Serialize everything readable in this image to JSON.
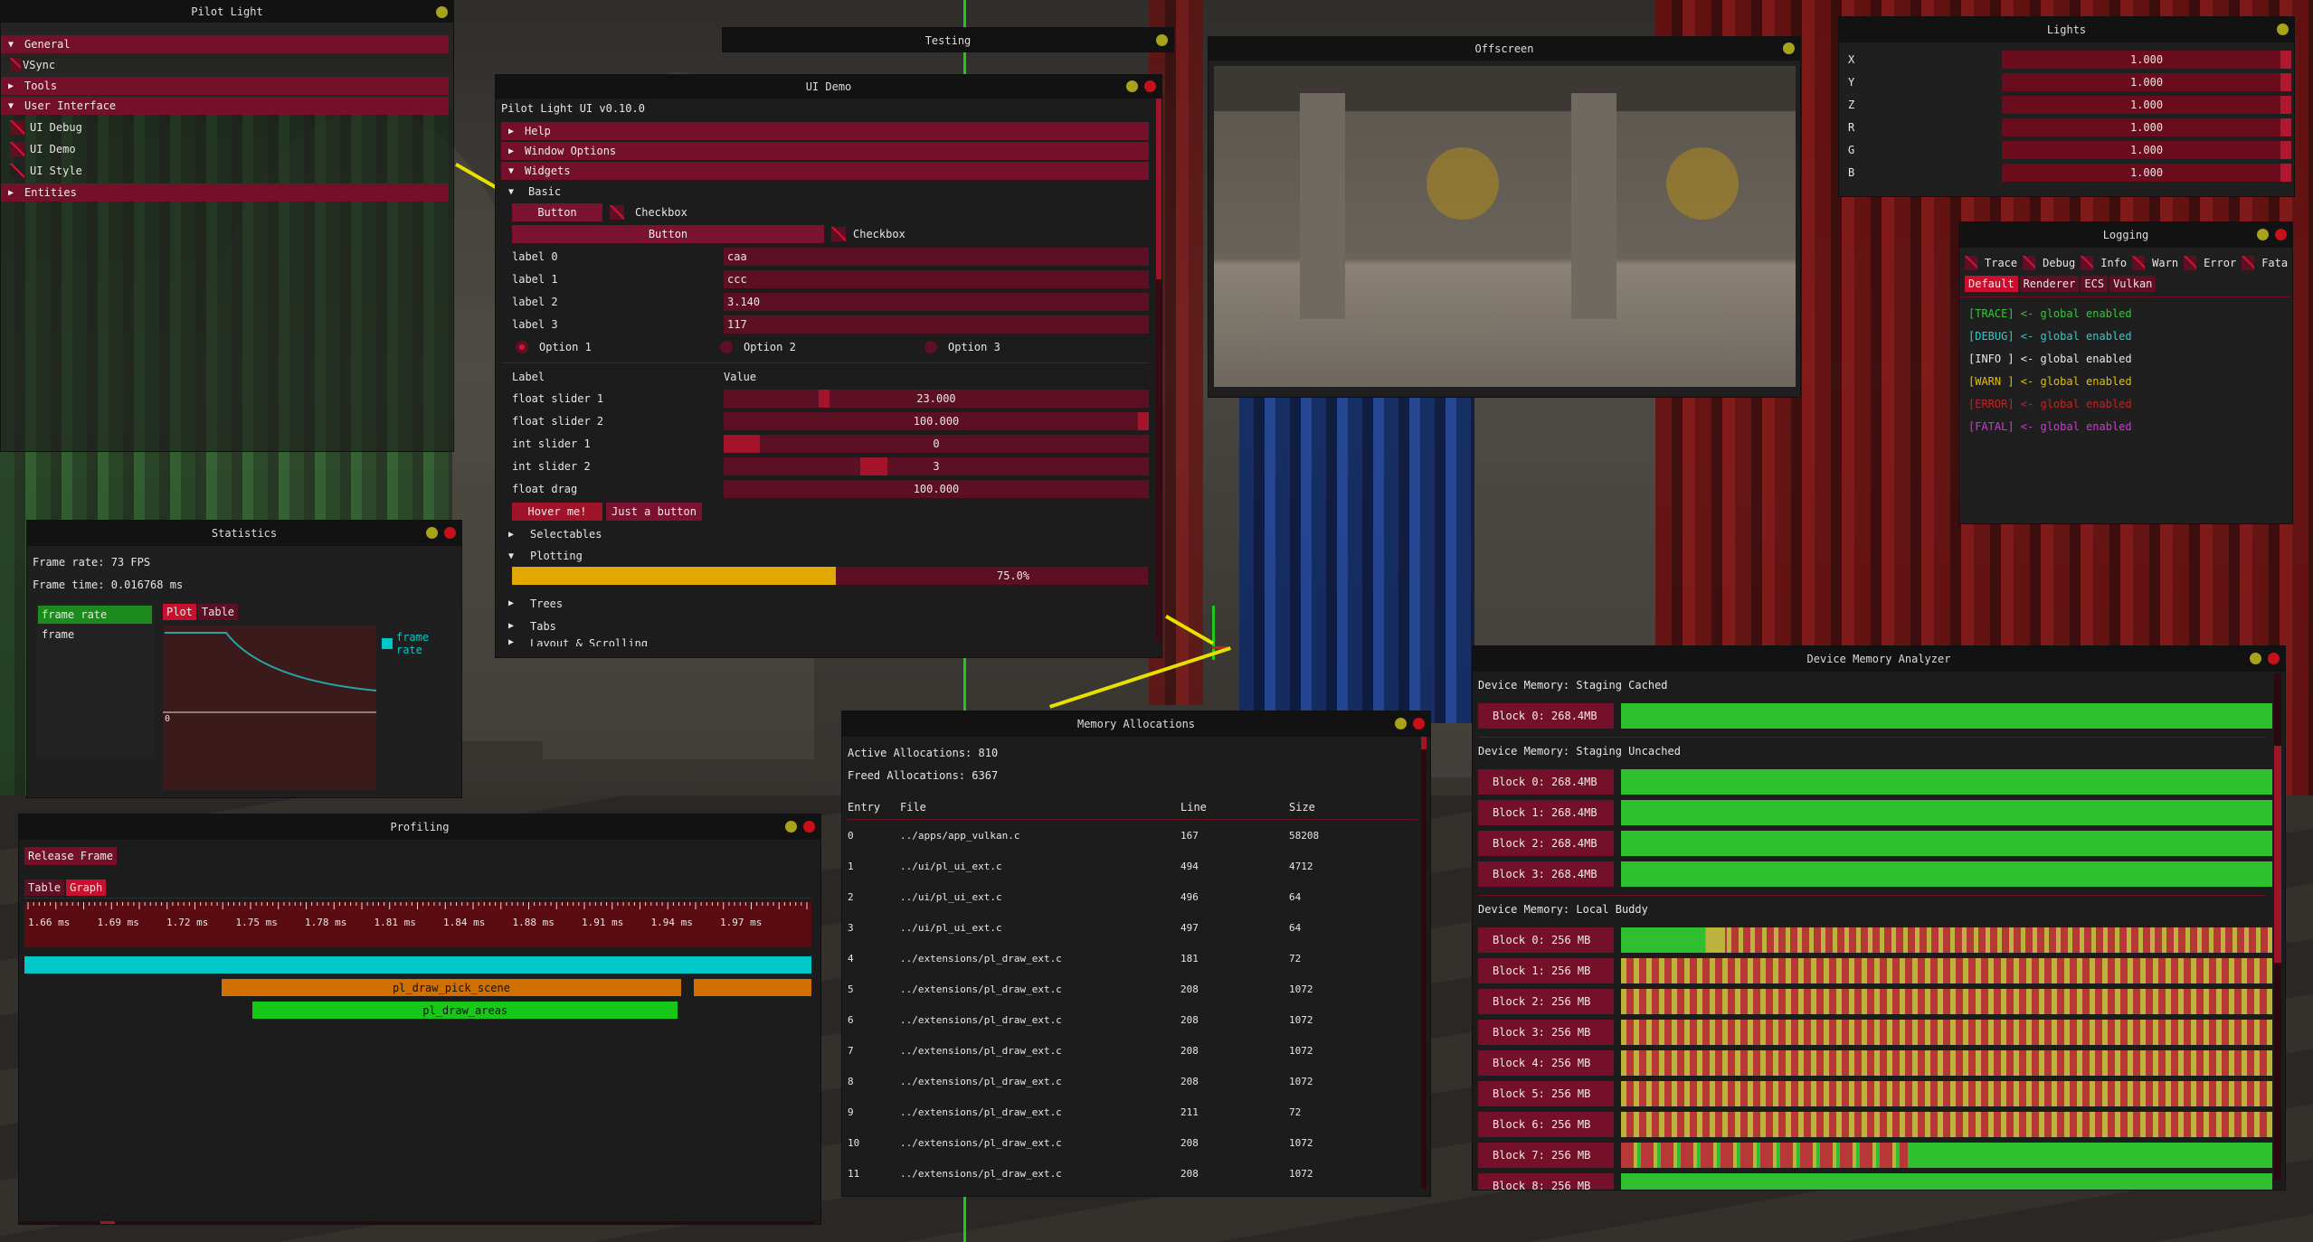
{
  "pilot_light": {
    "title": "Pilot Light",
    "items": [
      {
        "label": "General",
        "kind": "header",
        "open": true
      },
      {
        "label": "VSync",
        "kind": "check"
      },
      {
        "label": "Tools",
        "kind": "header",
        "open": false
      },
      {
        "label": "User Interface",
        "kind": "header",
        "open": true
      },
      {
        "label": "UI Debug",
        "kind": "check"
      },
      {
        "label": "UI Demo",
        "kind": "check"
      },
      {
        "label": "UI Style",
        "kind": "check"
      },
      {
        "label": "Entities",
        "kind": "header",
        "open": false
      }
    ]
  },
  "testing": {
    "title": "Testing"
  },
  "ui_demo": {
    "title": "UI Demo",
    "version": "Pilot Light UI v0.10.0",
    "headers": {
      "help": "Help",
      "window_options": "Window Options",
      "widgets": "Widgets",
      "basic": "Basic"
    },
    "button": "Button",
    "checkbox": "Checkbox",
    "button2": "Button",
    "checkbox2": "Checkbox",
    "labels": [
      {
        "label": "label 0",
        "value": "caa"
      },
      {
        "label": "label 1",
        "value": "ccc"
      },
      {
        "label": "label 2",
        "value": "3.140"
      },
      {
        "label": "label 3",
        "value": "117"
      }
    ],
    "options": [
      "Option 1",
      "Option 2",
      "Option 3"
    ],
    "col_label": "Label",
    "col_value": "Value",
    "sliders": [
      {
        "label": "float slider 1",
        "value": "23.000",
        "fraction": 0.23
      },
      {
        "label": "float slider 2",
        "value": "100.000",
        "fraction": 1.0
      },
      {
        "label": "int slider 1",
        "value": "0",
        "fraction": 0.0
      },
      {
        "label": "int slider 2",
        "value": "3",
        "fraction": 0.33
      },
      {
        "label": "float drag",
        "value": "100.000",
        "fraction": null
      }
    ],
    "hover_button": "Hover me!",
    "just_button": "Just a button",
    "selectables": "Selectables",
    "plotting": "Plotting",
    "progress_text": "75.0%",
    "progress": 0.75,
    "trees": "Trees",
    "tabs": "Tabs",
    "cut_header": "Layout & Scrolling"
  },
  "offscreen": {
    "title": "Offscreen"
  },
  "lights": {
    "title": "Lights",
    "rows": [
      {
        "label": "X",
        "value": "1.000"
      },
      {
        "label": "Y",
        "value": "1.000"
      },
      {
        "label": "Z",
        "value": "1.000"
      },
      {
        "label": "R",
        "value": "1.000"
      },
      {
        "label": "G",
        "value": "1.000"
      },
      {
        "label": "B",
        "value": "1.000"
      }
    ]
  },
  "logging": {
    "title": "Logging",
    "levels": [
      "Trace",
      "Debug",
      "Info",
      "Warn",
      "Error",
      "Fata"
    ],
    "channels": [
      "Default",
      "Renderer",
      "ECS",
      "Vulkan"
    ],
    "lines": [
      {
        "text": "[TRACE] <- global enabled",
        "color": "#39c339"
      },
      {
        "text": "[DEBUG] <- global enabled",
        "color": "#35c9c9"
      },
      {
        "text": "[INFO ] <- global enabled",
        "color": "#e8e8e8"
      },
      {
        "text": "[WARN ] <- global enabled",
        "color": "#e0c000"
      },
      {
        "text": "[ERROR] <- global enabled",
        "color": "#c82020"
      },
      {
        "text": "[FATAL] <- global enabled",
        "color": "#d236d2"
      }
    ]
  },
  "statistics": {
    "title": "Statistics",
    "frame_rate": "Frame rate: 73 FPS",
    "frame_time": "Frame time: 0.016768 ms",
    "list": [
      "frame rate",
      "frame"
    ],
    "tabs": [
      "Plot",
      "Table"
    ],
    "legend": "frame rate",
    "axis_zero": "0"
  },
  "profiling": {
    "title": "Profiling",
    "release": "Release Frame",
    "tabs": [
      "Table",
      "Graph"
    ],
    "ticks": [
      "1.66 ms",
      "1.69 ms",
      "1.72 ms",
      "1.75 ms",
      "1.78 ms",
      "1.81 ms",
      "1.84 ms",
      "1.88 ms",
      "1.91 ms",
      "1.94 ms",
      "1.97 ms"
    ],
    "bars": [
      {
        "label": "",
        "color": "#00c8c8",
        "start": 0.0,
        "end": 1.0,
        "lane": 0
      },
      {
        "label": "pl_draw_pick_scene",
        "color": "#d07000",
        "start": 0.25,
        "end": 0.835,
        "lane": 1
      },
      {
        "label": "",
        "color": "#d07000",
        "start": 0.85,
        "end": 1.0,
        "lane": 1
      },
      {
        "label": "pl_draw_areas",
        "color": "#18c818",
        "start": 0.29,
        "end": 0.83,
        "lane": 2
      }
    ]
  },
  "memory": {
    "title": "Memory Allocations",
    "active": "Active Allocations: 810",
    "freed": "Freed Allocations: 6367",
    "cols": [
      "Entry",
      "File",
      "Line",
      "Size"
    ],
    "rows": [
      [
        "0",
        "../apps/app_vulkan.c",
        "167",
        "58208"
      ],
      [
        "1",
        "../ui/pl_ui_ext.c",
        "494",
        "4712"
      ],
      [
        "2",
        "../ui/pl_ui_ext.c",
        "496",
        "64"
      ],
      [
        "3",
        "../ui/pl_ui_ext.c",
        "497",
        "64"
      ],
      [
        "4",
        "../extensions/pl_draw_ext.c",
        "181",
        "72"
      ],
      [
        "5",
        "../extensions/pl_draw_ext.c",
        "208",
        "1072"
      ],
      [
        "6",
        "../extensions/pl_draw_ext.c",
        "208",
        "1072"
      ],
      [
        "7",
        "../extensions/pl_draw_ext.c",
        "208",
        "1072"
      ],
      [
        "8",
        "../extensions/pl_draw_ext.c",
        "208",
        "1072"
      ],
      [
        "9",
        "../extensions/pl_draw_ext.c",
        "211",
        "72"
      ],
      [
        "10",
        "../extensions/pl_draw_ext.c",
        "208",
        "1072"
      ],
      [
        "11",
        "../extensions/pl_draw_ext.c",
        "208",
        "1072"
      ]
    ]
  },
  "dma": {
    "title": "Device Memory Analyzer",
    "sections": [
      {
        "title": "Device Memory: Staging Cached",
        "blocks": [
          {
            "label": "Block 0: 268.4MB",
            "pattern": "full"
          }
        ]
      },
      {
        "title": "Device Memory: Staging Uncached",
        "blocks": [
          {
            "label": "Block 0: 268.4MB",
            "pattern": "full"
          },
          {
            "label": "Block 1: 268.4MB",
            "pattern": "full"
          },
          {
            "label": "Block 2: 268.4MB",
            "pattern": "full"
          },
          {
            "label": "Block 3: 268.4MB",
            "pattern": "full"
          }
        ]
      },
      {
        "title": "Device Memory: Local Buddy",
        "blocks": [
          {
            "label": "Block 0: 256 MB",
            "pattern": "b0"
          },
          {
            "label": "Block 1: 256 MB",
            "pattern": "stripe"
          },
          {
            "label": "Block 2: 256 MB",
            "pattern": "stripe"
          },
          {
            "label": "Block 3: 256 MB",
            "pattern": "stripe"
          },
          {
            "label": "Block 4: 256 MB",
            "pattern": "stripe"
          },
          {
            "label": "Block 5: 256 MB",
            "pattern": "stripe"
          },
          {
            "label": "Block 6: 256 MB",
            "pattern": "stripe"
          },
          {
            "label": "Block 7: 256 MB",
            "pattern": "b7"
          },
          {
            "label": "Block 8: 256 MB",
            "pattern": "full"
          }
        ]
      }
    ]
  },
  "colors": {
    "accent": "#75102a",
    "active": "#c8102e",
    "green": "#2fc02f",
    "red": "#b83838",
    "olive": "#bdb23c",
    "cyan": "#00c8c8",
    "orange": "#d07000"
  }
}
